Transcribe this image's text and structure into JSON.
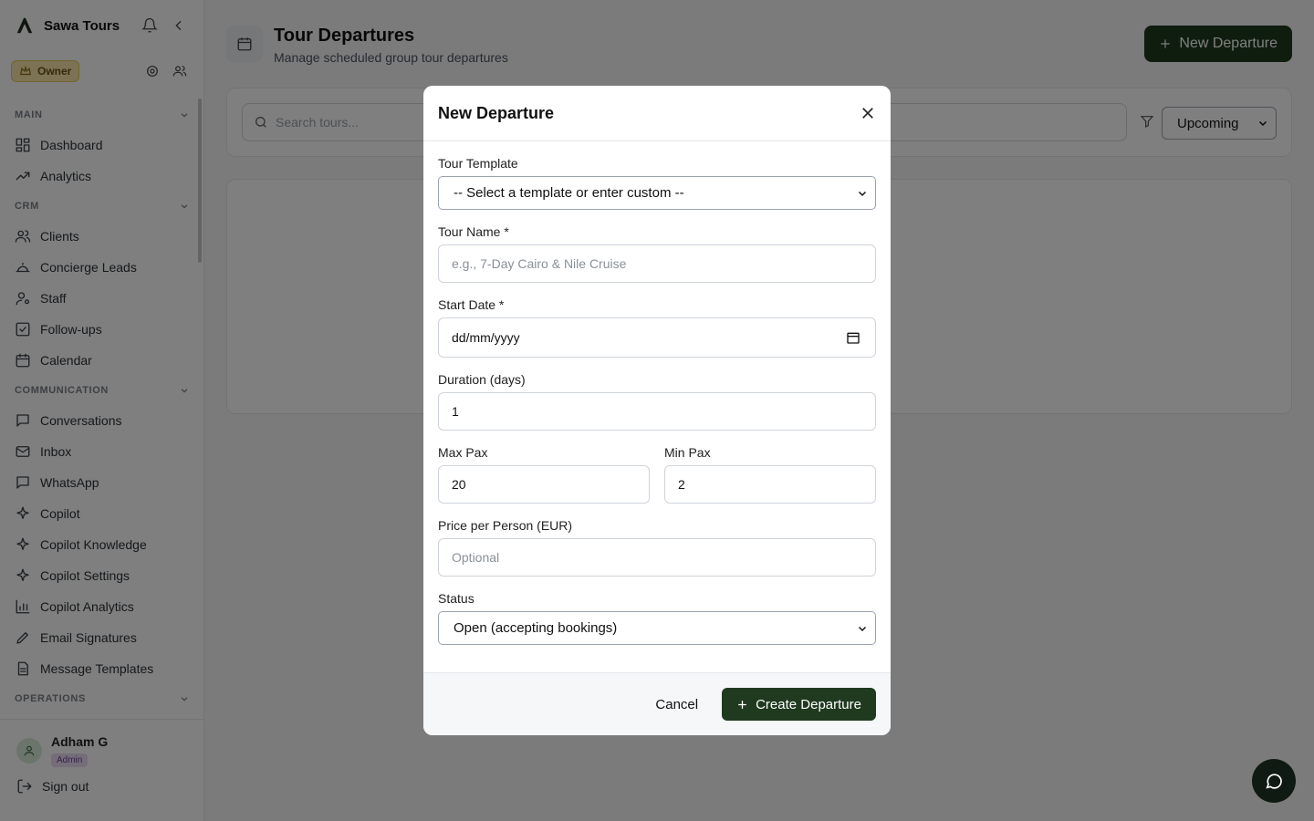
{
  "brand": {
    "name": "Sawa Tours"
  },
  "role": {
    "label": "Owner"
  },
  "sidebar": {
    "sections": [
      {
        "title": "MAIN",
        "items": [
          {
            "label": "Dashboard",
            "icon": "dashboard-icon"
          },
          {
            "label": "Analytics",
            "icon": "trending-up-icon"
          }
        ]
      },
      {
        "title": "CRM",
        "items": [
          {
            "label": "Clients",
            "icon": "users-icon"
          },
          {
            "label": "Concierge Leads",
            "icon": "concierge-bell-icon"
          },
          {
            "label": "Staff",
            "icon": "user-cog-icon"
          },
          {
            "label": "Follow-ups",
            "icon": "checkbox-icon"
          },
          {
            "label": "Calendar",
            "icon": "calendar-icon"
          }
        ]
      },
      {
        "title": "COMMUNICATION",
        "items": [
          {
            "label": "Conversations",
            "icon": "message-square-icon"
          },
          {
            "label": "Inbox",
            "icon": "mail-icon"
          },
          {
            "label": "WhatsApp",
            "icon": "message-square-icon"
          },
          {
            "label": "Copilot",
            "icon": "sparkles-icon"
          },
          {
            "label": "Copilot Knowledge",
            "icon": "sparkles-icon"
          },
          {
            "label": "Copilot Settings",
            "icon": "sparkles-icon"
          },
          {
            "label": "Copilot Analytics",
            "icon": "bar-chart-icon"
          },
          {
            "label": "Email Signatures",
            "icon": "pen-icon"
          },
          {
            "label": "Message Templates",
            "icon": "file-text-icon"
          }
        ]
      },
      {
        "title": "OPERATIONS",
        "items": []
      }
    ]
  },
  "user": {
    "name": "Adham G",
    "badge": "Admin",
    "signout": "Sign out"
  },
  "page": {
    "title": "Tour Departures",
    "subtitle": "Manage scheduled group tour departures",
    "new_button": "New Departure"
  },
  "filters": {
    "search_placeholder": "Search tours...",
    "status_value": "Upcoming"
  },
  "modal": {
    "title": "New Departure",
    "template_label": "Tour Template",
    "template_value": "-- Select a template or enter custom --",
    "name_label": "Tour Name *",
    "name_placeholder": "e.g., 7-Day Cairo & Nile Cruise",
    "start_label": "Start Date *",
    "start_placeholder": "dd/mm/yyyy",
    "duration_label": "Duration (days)",
    "duration_value": "1",
    "max_label": "Max Pax",
    "max_value": "20",
    "min_label": "Min Pax",
    "min_value": "2",
    "price_label": "Price per Person (EUR)",
    "price_placeholder": "Optional",
    "status_label": "Status",
    "status_value": "Open (accepting bookings)",
    "cancel": "Cancel",
    "create": "Create Departure"
  }
}
